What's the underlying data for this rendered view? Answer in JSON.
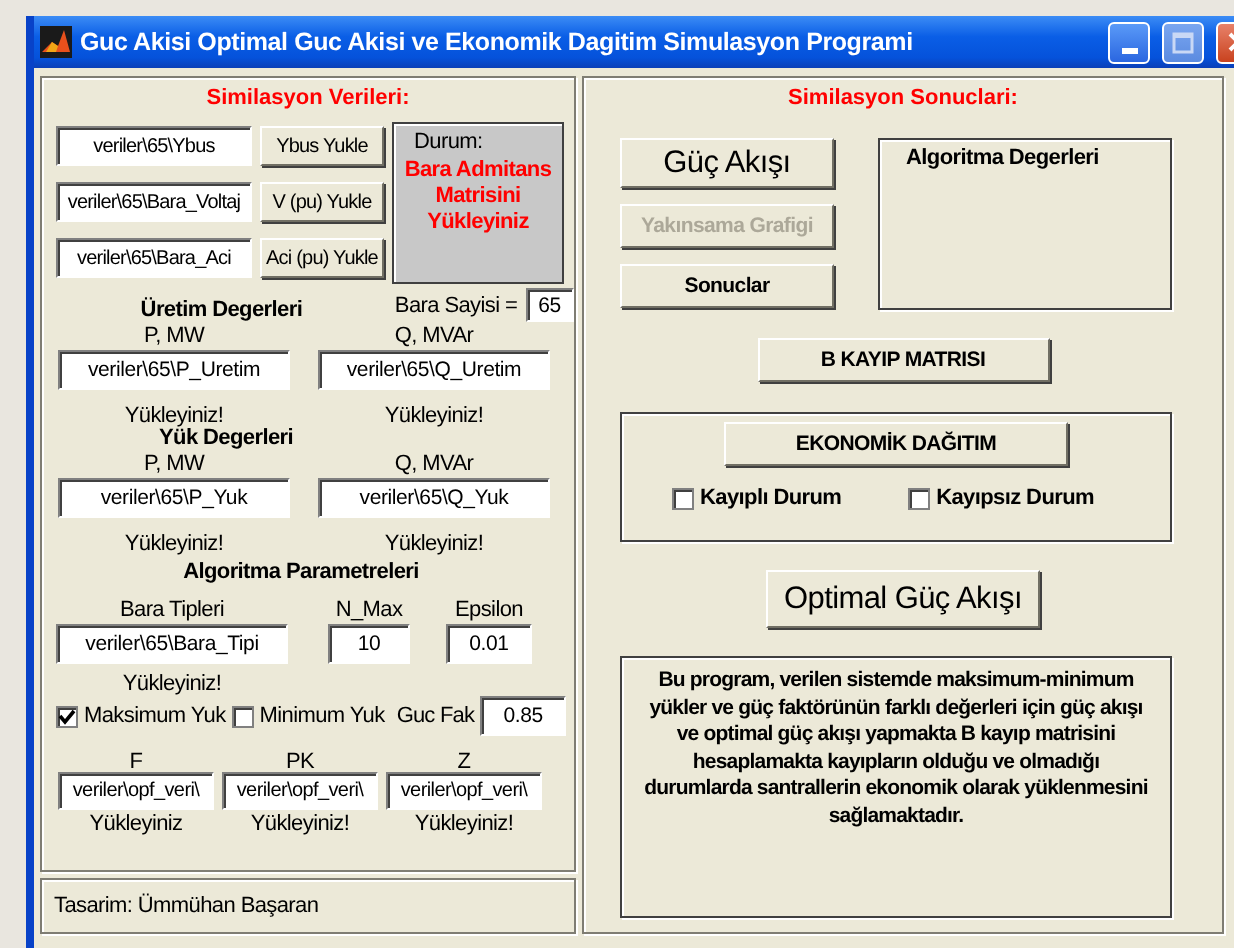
{
  "window": {
    "title": "Guc Akisi Optimal Guc Akisi ve Ekonomik Dagitim Simulasyon Programi"
  },
  "left_panel": {
    "title": "Similasyon Verileri:",
    "load_rows": [
      {
        "path": "veriler\\65\\Ybus",
        "button": "Ybus Yukle"
      },
      {
        "path": "veriler\\65\\Bara_Voltaj",
        "button": "V (pu) Yukle"
      },
      {
        "path": "veriler\\65\\Bara_Aci",
        "button": "Aci (pu) Yukle"
      }
    ],
    "status": {
      "label": "Durum:",
      "message": "Bara Admitans Matrisini Yükleyiniz"
    },
    "bus_count": {
      "label": "Bara Sayisi =",
      "value": "65"
    },
    "groups": [
      {
        "title": "Üretim Degerleri",
        "fields": [
          {
            "label": "P, MW",
            "value": "veriler\\65\\P_Uretim",
            "status": "Yükleyiniz!"
          },
          {
            "label": "Q, MVAr",
            "value": "veriler\\65\\Q_Uretim",
            "status": "Yükleyiniz!"
          }
        ]
      },
      {
        "title": "Yük Degerleri",
        "fields": [
          {
            "label": "P, MW",
            "value": "veriler\\65\\P_Yuk",
            "status": "Yükleyiniz!"
          },
          {
            "label": "Q, MVAr",
            "value": "veriler\\65\\Q_Yuk",
            "status": "Yükleyiniz!"
          }
        ]
      }
    ],
    "algorithm": {
      "title": "Algoritma Parametreleri",
      "bus_types": {
        "label": "Bara Tipleri",
        "value": "veriler\\65\\Bara_Tipi",
        "status": "Yükleyiniz!"
      },
      "n_max": {
        "label": "N_Max",
        "value": "10"
      },
      "epsilon": {
        "label": "Epsilon",
        "value": "0.01"
      },
      "options": [
        {
          "label": "Maksimum Yuk",
          "checked": true
        },
        {
          "label": "Minimum Yuk",
          "checked": false
        }
      ],
      "power_factor": {
        "label": "Guc Fak",
        "value": "0.85"
      },
      "opf_fields": [
        {
          "label": "F",
          "value": "veriler\\opf_veri\\",
          "status": "Yükleyiniz"
        },
        {
          "label": "PK",
          "value": "veriler\\opf_veri\\",
          "status": "Yükleyiniz!"
        },
        {
          "label": "Z",
          "value": "veriler\\opf_veri\\",
          "status": "Yükleyiniz!"
        }
      ]
    }
  },
  "footer": {
    "text": "Tasarim: Ümmühan Başaran"
  },
  "right_panel": {
    "title": "Similasyon Sonuclari:",
    "buttons": [
      {
        "label": "Güç Akışı",
        "disabled": false,
        "kind": "large"
      },
      {
        "label": "Yakınsama Grafigi",
        "disabled": true,
        "kind": "normal"
      },
      {
        "label": "Sonuclar",
        "disabled": false,
        "kind": "normal"
      }
    ],
    "results_box": {
      "title": "Algoritma Degerleri"
    },
    "loss_matrix_button": "B KAYIP MATRISI",
    "economic": {
      "button": "EKONOMİK DAĞITIM",
      "options": [
        {
          "label": "Kayıplı Durum",
          "checked": false
        },
        {
          "label": "Kayıpsız Durum",
          "checked": false
        }
      ]
    },
    "opf_button": "Optimal Güç Akışı",
    "description": "Bu program, verilen sistemde maksimum-minimum\nyükler ve güç faktörünün farklı değerleri için güç akışı\nve optimal güç akışı yapmakta B kayıp matrisini\nhesaplamakta kayıpların olduğu ve olmadığı\ndurumlarda santrallerin ekonomik olarak yüklenmesini\nsağlamaktadır."
  }
}
